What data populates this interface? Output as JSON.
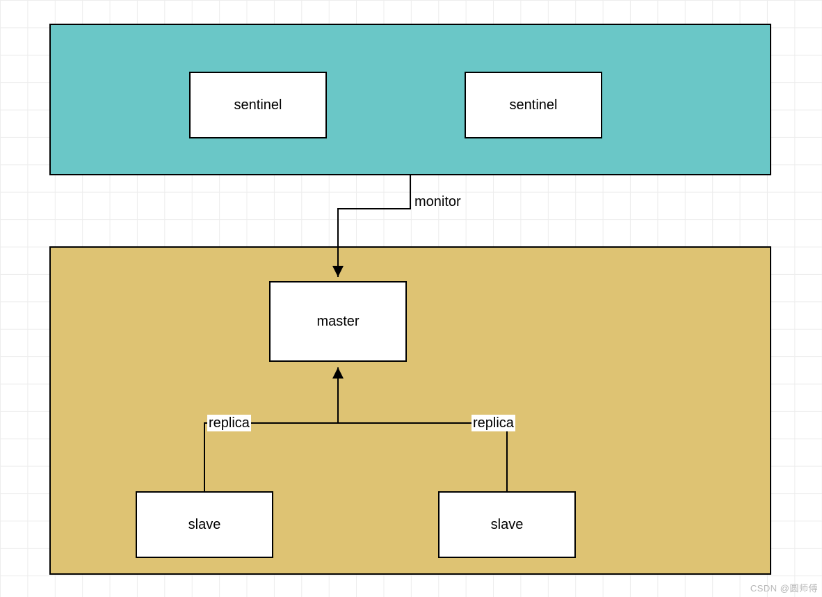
{
  "nodes": {
    "sentinel1": "sentinel",
    "sentinel2": "sentinel",
    "master": "master",
    "slave1": "slave",
    "slave2": "slave"
  },
  "edges": {
    "monitor": "monitor",
    "replica1": "replica",
    "replica2": "replica"
  },
  "watermark": "CSDN @圆师傅",
  "colors": {
    "sentinel_region": "#6ac7c7",
    "cluster_region": "#dec373",
    "node_bg": "#ffffff",
    "border": "#000000"
  }
}
